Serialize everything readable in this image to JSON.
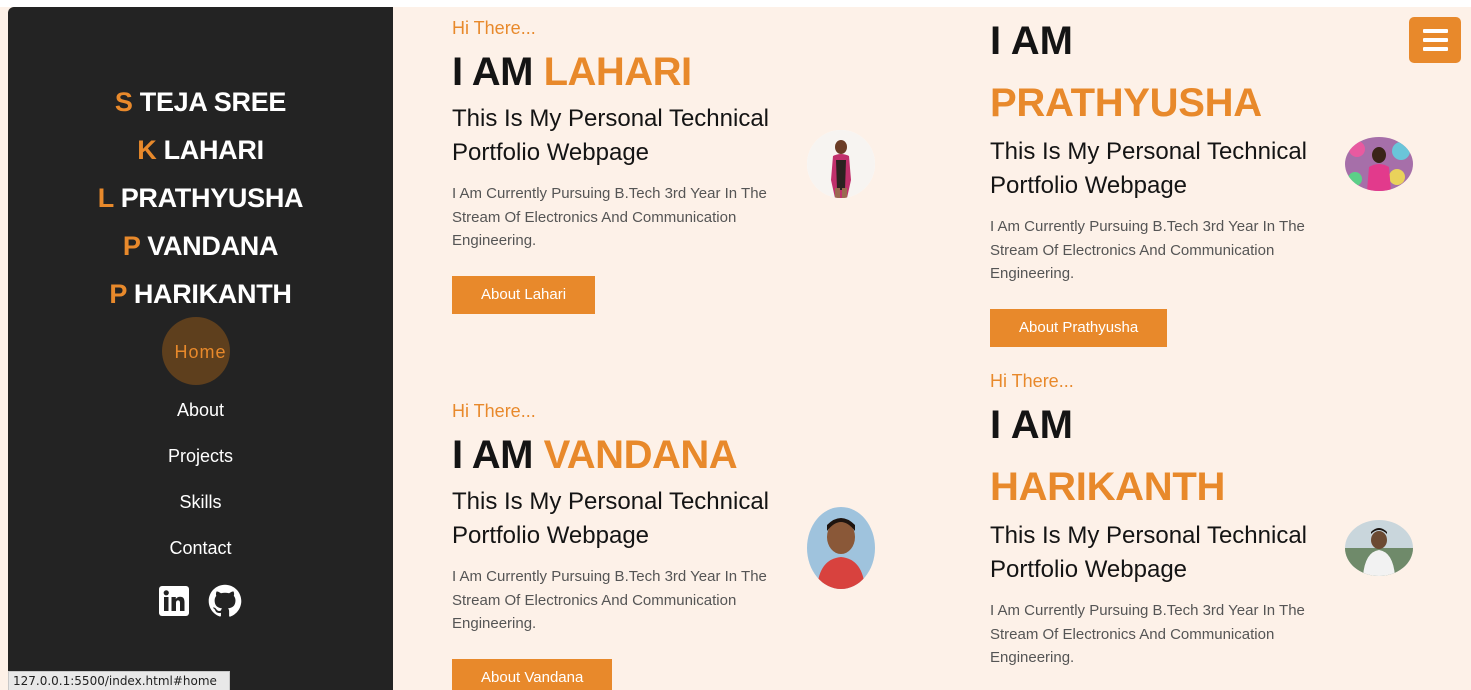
{
  "sidebar": {
    "members": [
      {
        "initial": "S",
        "name": "TEJA SREE"
      },
      {
        "initial": "K",
        "name": "LAHARI"
      },
      {
        "initial": "L",
        "name": "PRATHYUSHA"
      },
      {
        "initial": "P",
        "name": "VANDANA"
      },
      {
        "initial": "P",
        "name": "HARIKANTH"
      }
    ],
    "nav": [
      "Home",
      "About",
      "Projects",
      "Skills",
      "Contact"
    ],
    "active_nav": "Home",
    "socials": [
      "linkedin-icon",
      "github-icon"
    ]
  },
  "status_bar": {
    "url": "127.0.0.1:5500/index.html#home"
  },
  "cards": [
    {
      "greeting": "Hi There...",
      "iam": "I AM",
      "name": "LAHARI",
      "tagline": "This Is My Personal Technical Portfolio Webpage",
      "description": "I Am Currently Pursuing B.Tech 3rd Year In The Stream Of Electronics And Communication Engineering.",
      "button": "About Lahari"
    },
    {
      "greeting": "",
      "iam": "I AM",
      "name": "PRATHYUSHA",
      "tagline": "This Is My Personal Technical Portfolio Webpage",
      "description": "I Am Currently Pursuing B.Tech 3rd Year In The Stream Of Electronics And Communication Engineering.",
      "button": "About Prathyusha"
    },
    {
      "greeting": "Hi There...",
      "iam": "I AM",
      "name": "VANDANA",
      "tagline": "This Is My Personal Technical Portfolio Webpage",
      "description": "I Am Currently Pursuing B.Tech 3rd Year In The Stream Of Electronics And Communication Engineering.",
      "button": "About Vandana"
    },
    {
      "greeting": "Hi There...",
      "iam": "I AM",
      "name": "HARIKANTH",
      "tagline": "This Is My Personal Technical Portfolio Webpage",
      "description": "I Am Currently Pursuing B.Tech 3rd Year In The Stream Of Electronics And Communication Engineering.",
      "button": ""
    }
  ],
  "colors": {
    "accent": "#e8892b",
    "sidebar": "#232323",
    "background": "#fdf1e8"
  },
  "menu_button": {
    "icon": "hamburger-menu-icon"
  }
}
